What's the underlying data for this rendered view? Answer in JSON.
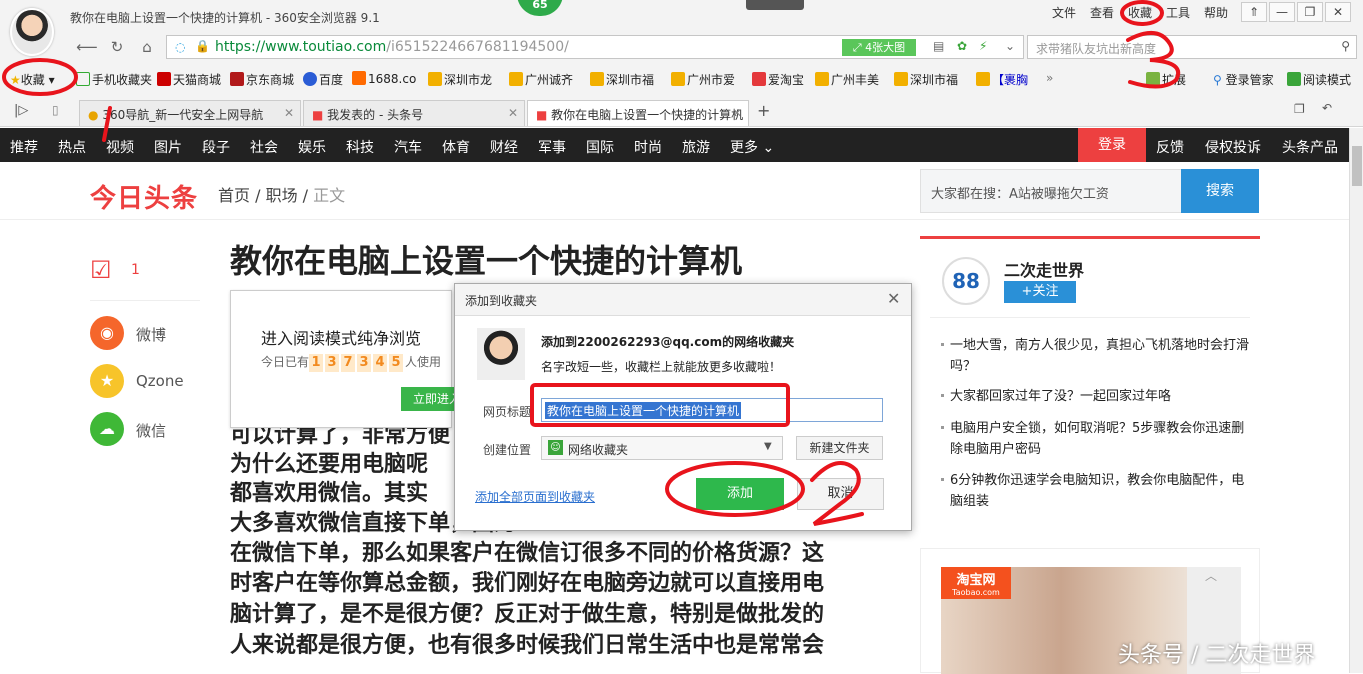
{
  "browser": {
    "title": "教你在电脑上设置一个快捷的计算机 - 360安全浏览器 9.1",
    "badge_count": "65",
    "menu": [
      "文件",
      "查看",
      "收藏",
      "工具",
      "帮助"
    ],
    "url_host": "https://www.toutiao.com",
    "url_path": "/i6515224667681194500/",
    "image_button": "4张大图",
    "search_placeholder": "求带猪队友坑出新高度",
    "bookmarks_label": "收藏",
    "bookmarks": [
      "手机收藏夹",
      "天猫商城",
      "京东商城",
      "百度",
      "1688.co",
      "深圳市龙",
      "广州诚齐",
      "深圳市福",
      "广州市爱",
      "爱淘宝",
      "广州丰美",
      "深圳市福",
      "【裹胸"
    ],
    "extensions_label": "扩展",
    "login_manager": "登录管家",
    "read_mode": "阅读模式",
    "tabs": [
      "360导航_新一代安全上网导航",
      "我发表的 - 头条号",
      "教你在电脑上设置一个快捷的计算机"
    ],
    "tab_icons": [
      "360-icon",
      "toutiao-icon",
      "toutiao-icon"
    ]
  },
  "site_nav": {
    "items": [
      "推荐",
      "热点",
      "视频",
      "图片",
      "段子",
      "社会",
      "娱乐",
      "科技",
      "汽车",
      "体育",
      "财经",
      "军事",
      "国际",
      "时尚",
      "旅游",
      "更多"
    ],
    "login": "登录",
    "right_items": [
      "反馈",
      "侵权投诉",
      "头条产品"
    ]
  },
  "header": {
    "logo": "今日头条",
    "breadcrumb": [
      "首页",
      "职场",
      "正文"
    ],
    "search_text": "大家都在搜：A站被曝拖欠工资",
    "search_button": "搜索"
  },
  "share": {
    "comment_count": "1",
    "items": [
      "微博",
      "Qzone",
      "微信"
    ]
  },
  "article": {
    "title": "教你在电脑上设置一个快捷的计算机",
    "lines": [
      "可以计算了，非常方便",
      "为什么还要用电脑呢",
      "都喜欢用微信。其实",
      "大多喜欢微信直接下单，因为…",
      "在微信下单，那么如果客户在微信订很多不同的价格货源？这",
      "时客户在等你算总金额，我们刚好在电脑旁边就可以直接用电",
      "脑计算了，是不是很方便？反正对于做生意，特别是做批发的",
      "人来说都是很方便，也有很多时候我们日常生活中也是常常会"
    ]
  },
  "reader_popup": {
    "title": "进入阅读模式纯净浏览",
    "prefix": "今日已有",
    "digits": [
      "1",
      "3",
      "7",
      "3",
      "4",
      "5"
    ],
    "suffix": "人使用",
    "button": "立即进入"
  },
  "dialog": {
    "title": "添加到收藏夹",
    "account_line": "添加到2200262293@qq.com的网络收藏夹",
    "hint": "名字改短一些，收藏栏上就能放更多收藏啦！",
    "title_label": "网页标题",
    "title_value": "教你在电脑上设置一个快捷的计算机",
    "location_label": "创建位置",
    "location_value": "网络收藏夹",
    "new_folder": "新建文件夹",
    "add_all": "添加全部页面到收藏夹",
    "add_button": "添加",
    "cancel_button": "取消"
  },
  "sidebar": {
    "author": "二次走世界",
    "follow": "+关注",
    "news": [
      "一地大雪，南方人很少见，真担心飞机落地时会打滑吗？",
      "大家都回家过年了没？一起回家过年咯",
      "电脑用户安全锁，如何取消呢？5步骤教会你迅速删除电脑用户密码",
      "6分钟教你迅速学会电脑知识，教会你电脑配件，电脑组装"
    ],
    "ad_brand": "淘宝网",
    "ad_domain": "Taobao.com"
  },
  "annotations": [
    "1",
    "2",
    "3"
  ],
  "watermark": "头条号 / 二次走世界",
  "colors": {
    "accent_red": "#ed4040",
    "nav_bg": "#222222",
    "add_green": "#2eb84c",
    "annotation_red": "#e8141c"
  }
}
